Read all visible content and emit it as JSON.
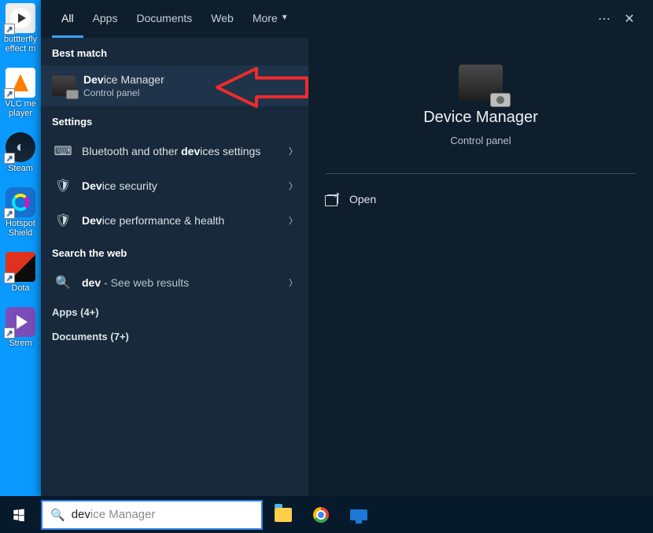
{
  "desktop": [
    {
      "label": "buttterfly effect m"
    },
    {
      "label": "VLC me player"
    },
    {
      "label": "Steam"
    },
    {
      "label": "Hotspot Shield"
    },
    {
      "label": "Dota"
    },
    {
      "label": "Strem"
    }
  ],
  "tabs": {
    "all": "All",
    "apps": "Apps",
    "documents": "Documents",
    "web": "Web",
    "more": "More"
  },
  "sections": {
    "best_match": "Best match",
    "settings": "Settings",
    "search_web": "Search the web",
    "apps_count": "Apps (4+)",
    "documents_count": "Documents (7+)"
  },
  "best_match": {
    "title_bold": "Dev",
    "title_rest": "ice Manager",
    "subtitle": "Control panel"
  },
  "settings_items": [
    {
      "prefix": "Bluetooth and other ",
      "bold": "dev",
      "suffix": "ices settings"
    },
    {
      "prefix": "",
      "bold": "Dev",
      "suffix": "ice security"
    },
    {
      "prefix": "",
      "bold": "Dev",
      "suffix": "ice performance & health"
    }
  ],
  "web": {
    "bold": "dev",
    "rest": " - See web results"
  },
  "hero": {
    "title": "Device Manager",
    "subtitle": "Control panel"
  },
  "actions": {
    "open": "Open"
  },
  "search": {
    "typed": "dev",
    "suggestion": "ice Manager"
  }
}
